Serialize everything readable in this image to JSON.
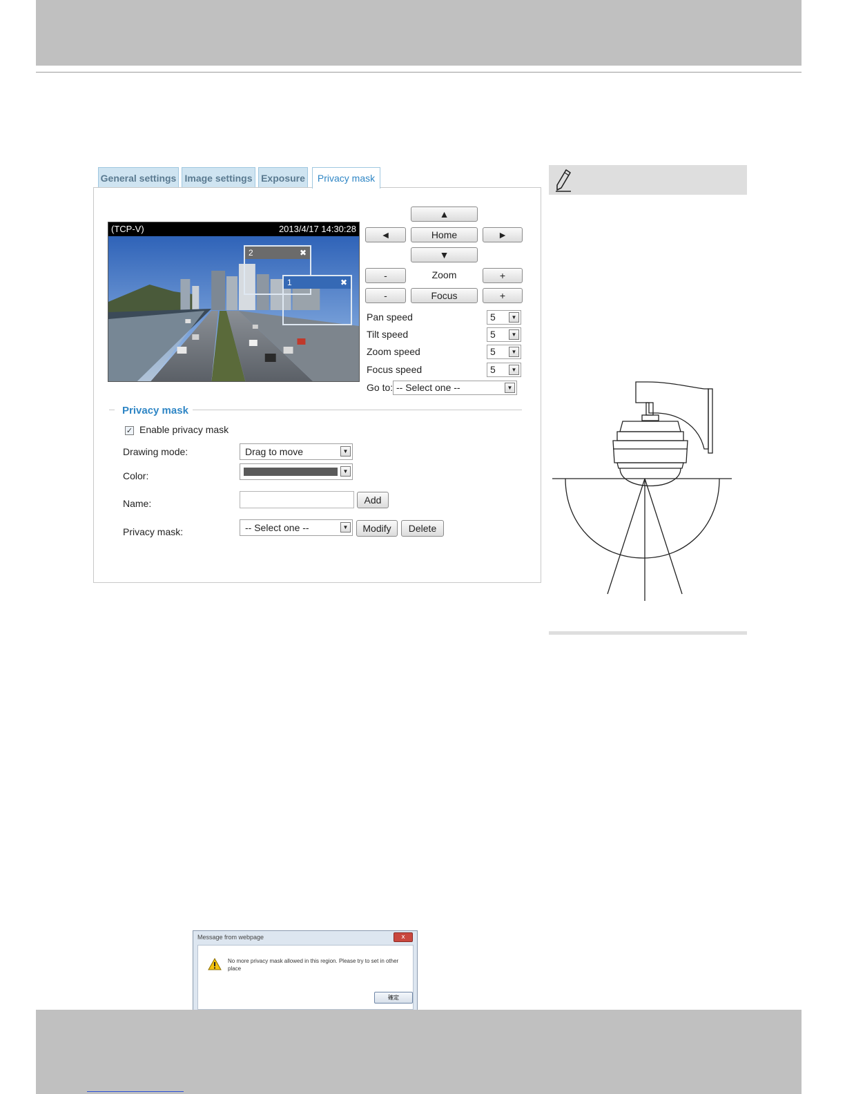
{
  "tabs": [
    {
      "label": "General settings"
    },
    {
      "label": "Image settings"
    },
    {
      "label": "Exposure"
    },
    {
      "label": "Privacy mask"
    }
  ],
  "video": {
    "stream_label": "(TCP-V)",
    "timestamp": "2013/4/17 14:30:28",
    "masks": [
      {
        "label": "2",
        "close": "✖"
      },
      {
        "label": "1",
        "close": "✖"
      }
    ]
  },
  "ptz": {
    "up": "▲",
    "left": "◄",
    "home": "Home",
    "right": "►",
    "down": "▼",
    "zoom_minus": "-",
    "zoom_label": "Zoom",
    "zoom_plus": "+",
    "focus_minus": "-",
    "focus_label": "Focus",
    "focus_plus": "+",
    "pan_speed_label": "Pan speed",
    "pan_speed": "5",
    "tilt_speed_label": "Tilt speed",
    "tilt_speed": "5",
    "zoom_speed_label": "Zoom speed",
    "zoom_speed": "5",
    "focus_speed_label": "Focus speed",
    "focus_speed": "5",
    "goto_label": "Go to:",
    "goto_value": "-- Select one --"
  },
  "privacy": {
    "section_title": "Privacy mask",
    "enable_label": "Enable privacy mask",
    "enabled": true,
    "drawing_mode_label": "Drawing mode:",
    "drawing_mode_value": "Drag to move",
    "color_label": "Color:",
    "color_value": "#5a5a5a",
    "name_label": "Name:",
    "name_value": "",
    "add_button": "Add",
    "mask_label": "Privacy mask:",
    "mask_value": "-- Select one --",
    "modify_button": "Modify",
    "delete_button": "Delete"
  },
  "dialog": {
    "title": "Message from webpage",
    "message": "No more privacy mask allowed in this region. Please try to set in other place",
    "ok_button": "確定",
    "close_button": "x"
  },
  "icons": {
    "note": "pencil-icon",
    "warning": "warning-icon"
  }
}
